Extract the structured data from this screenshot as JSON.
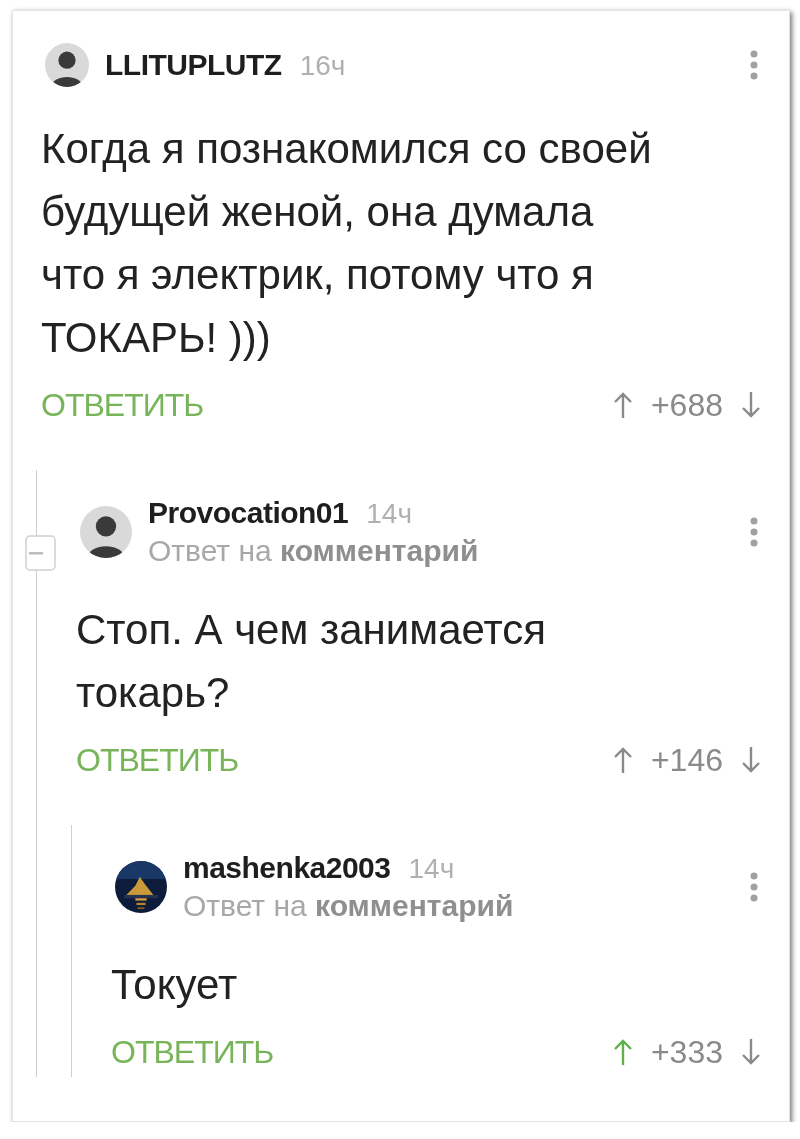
{
  "comments": [
    {
      "author": "LLITUPLUTZ",
      "time": "16ч",
      "avatar": {
        "kind": "figure"
      },
      "text": "Когда я познакомился со своей\nбудущей женой, она думала\nчто я электрик, потому что я\nТОКАРЬ! )))",
      "reply_label": "ОТВЕТИТЬ",
      "score": "+688",
      "upvoted": false,
      "expanded": true,
      "children": [
        {
          "author": "Provocation01",
          "time": "14ч",
          "avatar": {
            "kind": "figure"
          },
          "reply_to": "Ответ на **комментарий**",
          "text": "Стоп. А чем занимается\nтокарь?",
          "reply_label": "ОТВЕТИТЬ",
          "score": "+146",
          "upvoted": false,
          "children": [
            {
              "author": "mashenka2003",
              "time": "14ч",
              "reply_to": "Ответ на **комментарий**",
              "text": "Токует",
              "reply_label": "ОТВЕТИТЬ",
              "score": "+333",
              "upvoted": true
            }
          ]
        }
      ]
    }
  ]
}
